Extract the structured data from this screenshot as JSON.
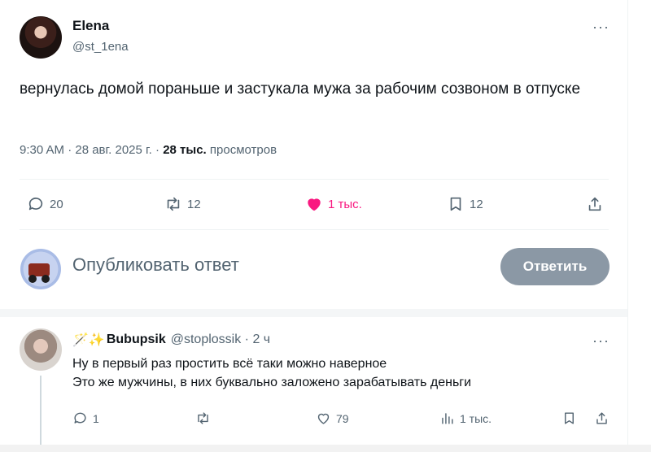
{
  "tweet": {
    "author_name": "Elena",
    "author_handle": "@st_1ena",
    "more_icon": "ellipsis-icon",
    "text": "вернулась домой пораньше и застукала мужа за рабочим созвоном в отпуске",
    "time": "9:30 AM · 28 авг. 2025 г. ·",
    "views_count": "28 тыс.",
    "views_label": "просмотров",
    "actions": {
      "replies": "20",
      "retweets": "12",
      "likes": "1 тыс.",
      "bookmarks": "12"
    },
    "like_color": "#f91880"
  },
  "composer": {
    "placeholder": "Опубликовать ответ",
    "button_label": "Ответить",
    "button_color": "#8b98a5"
  },
  "reply": {
    "emoji": "🪄✨",
    "author_name": "Bubupsik",
    "author_handle": "@stoplossik · 2 ч",
    "lines": [
      "Ну в первый раз простить всё таки можно наверное",
      "Это же мужчины, в них буквально заложено зарабатывать деньги"
    ],
    "actions": {
      "replies": "1",
      "retweets": "",
      "likes": "79",
      "views": "1 тыс."
    }
  }
}
